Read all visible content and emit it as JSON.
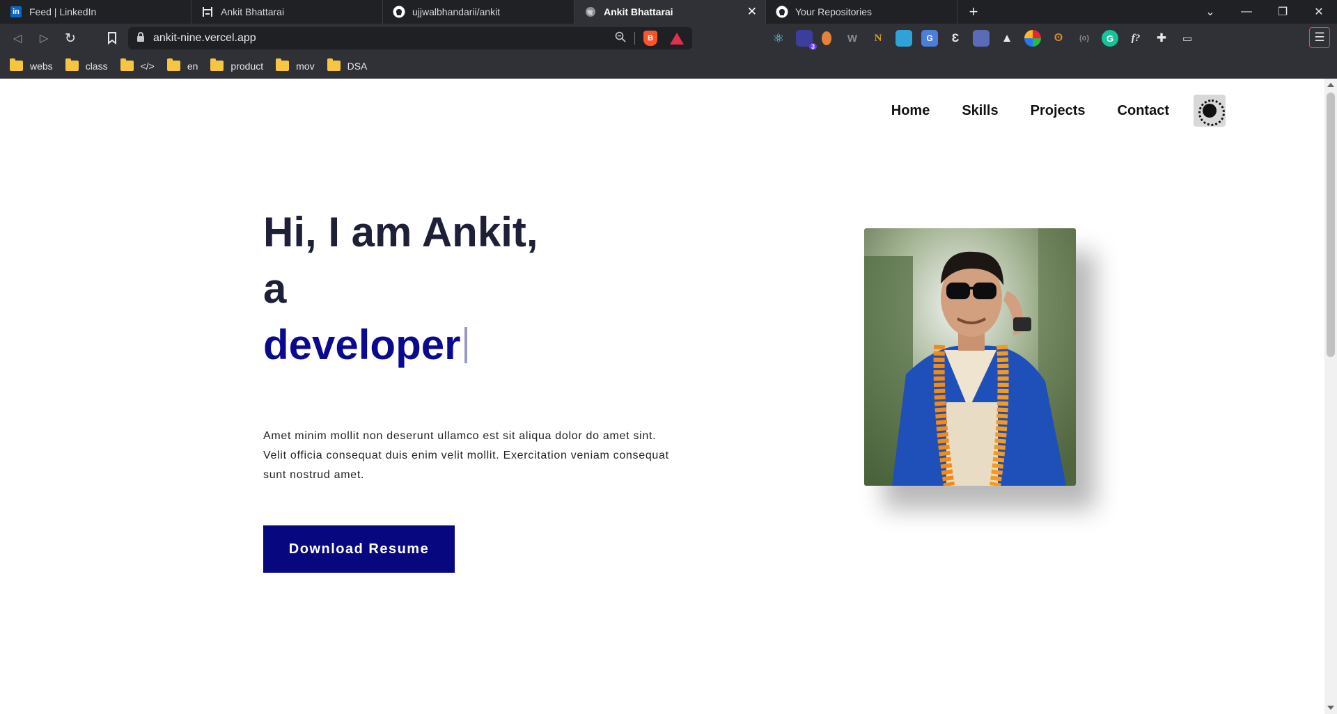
{
  "browser": {
    "tabs": [
      {
        "title": "Feed | LinkedIn",
        "icon": "linkedin-icon",
        "active": false
      },
      {
        "title": "Ankit Bhattarai",
        "icon": "site-logo-icon",
        "active": false
      },
      {
        "title": "ujjwalbhandarii/ankit",
        "icon": "github-icon",
        "active": false
      },
      {
        "title": "Ankit Bhattarai",
        "icon": "globe-icon",
        "active": true
      },
      {
        "title": "Your Repositories",
        "icon": "github-icon",
        "active": false
      }
    ],
    "url": "ankit-nine.vercel.app",
    "bookmarks": [
      "webs",
      "class",
      "</>",
      "en",
      "product",
      "mov",
      "DSA"
    ],
    "extension_badge": "3",
    "accent": "#e24b4b"
  },
  "nav": {
    "links": [
      "Home",
      "Skills",
      "Projects",
      "Contact"
    ],
    "theme_toggle_icon": "lightbulb-icon"
  },
  "hero": {
    "line1": "Hi, I am Ankit,",
    "line2": "a",
    "typed_word": "developer",
    "description": "Amet minim mollit non deserunt ullamco est sit aliqua dolor do amet sint. Velit officia consequat duis enim velit mollit. Exercitation veniam consequat sunt nostrud amet.",
    "button": "Download Resume",
    "colors": {
      "heading": "#1e2038",
      "typed": "#0a0a8f",
      "button": "#070780"
    }
  },
  "photo": {
    "icon": "profile-photo"
  }
}
